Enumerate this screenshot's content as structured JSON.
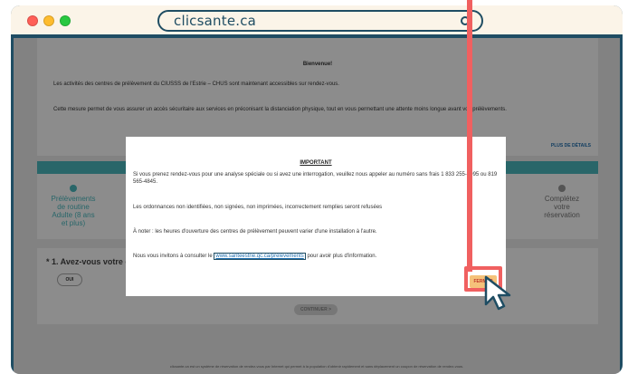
{
  "browser": {
    "url": "clicsante.ca"
  },
  "page": {
    "welcome_title": "Bienvenue!",
    "welcome_line1": "Les activités des centres de prélèvement du CIUSSS de l'Estrie – CHUS sont maintenant accessibles sur rendez-vous.",
    "welcome_line2": "Cette mesure permet de vous assurer un accès sécuritaire aux services en préconisant la distanciation physique, tout en vous permettant une attente moins longue avant vos prélèvements.",
    "details_link": "PLUS DE DÉTAILS",
    "step_left_lines": [
      "Prélèvements",
      "de routine",
      "Adulte (8 ans",
      "et plus)"
    ],
    "step_right_lines": [
      "Complétez",
      "votre",
      "réservation"
    ],
    "question": "* 1.  Avez-vous votre ca",
    "oui_button": "OUI",
    "continue_button": "CONTINUER  >",
    "footer": "clicsante.ca est un système de réservation de rendez-vous par Internet qui permet à la population d'obtenir rapidement et sans déplacement un coupon de réservation de rendez-vous."
  },
  "modal": {
    "title": "IMPORTANT",
    "p1": "Si vous prenez rendez-vous pour une analyse spéciale ou si avez une interrogation, veuillez nous appeler au numéro sans frais 1 833 255-1995 ou 819 565-4845.",
    "p2": "Les ordonnances non identifiées, non signées, non imprimées, incorrectement remplies seront refusées",
    "p3": "À noter : les heures d'ouverture des centres de prélèvement peuvent varier d'une installation à l'autre.",
    "p4_before": "Nous vous invitons à consulter le ",
    "p4_link": "www.santeestrie.qc.ca/prelevements",
    "p4_after": " pour avoir plus d'information.",
    "close_button": "FERMER"
  },
  "colors": {
    "frame": "#1f4d63",
    "teal": "#4bbbc0",
    "highlight": "#f06060",
    "fermer_bg": "#f5c27a"
  }
}
